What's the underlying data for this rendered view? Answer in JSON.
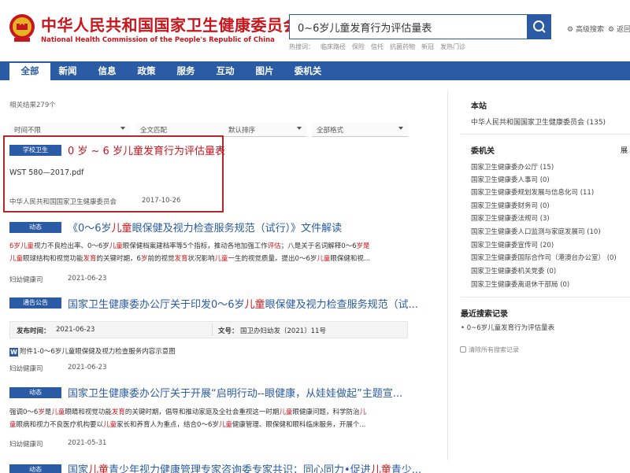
{
  "header": {
    "logo_cn": "中华人民共和国国家卫生健康委员会",
    "logo_en": "National Health Commission of the People's Republic of China",
    "search_value": "0~6岁儿童发育行为评估量表",
    "hot_label": "热搜词：",
    "hot_terms": [
      "临床路径",
      "保险",
      "信托",
      "抗菌药物",
      "新冠",
      "发热门诊"
    ],
    "adv_search": "高级搜索",
    "adv_search2": "返回"
  },
  "nav": [
    "全部",
    "新闻",
    "信息",
    "政策",
    "服务",
    "互动",
    "图片",
    "委机关"
  ],
  "result_count": "相关结果279个",
  "filters": [
    "时间不限",
    "全文匹配",
    "默认排序",
    "全部格式"
  ],
  "results": {
    "r1": {
      "tag": "学校卫生",
      "title": "0 岁 ~ 6 岁儿童发育行为评估量表",
      "file": "WST 580—2017.pdf",
      "source": "中华人民共和国国家卫生健康委员会",
      "date": "2017-10-26"
    },
    "r2": {
      "tag": "动态",
      "title_a": "《0～6岁",
      "title_b": "儿童",
      "title_c": "眼保健及视力检查服务规范（试行）》文件解读",
      "line1_a": "6岁",
      "line1_b": "儿童",
      "line1_c": "视力不良检出率、0～6岁",
      "line1_d": "儿童",
      "line1_e": "眼保健档案建档率等5个指标，推动各地加强工作",
      "line1_f": "评估",
      "line1_g": "；八是关于名词解释0～6",
      "line1_h": "岁是",
      "line2_a": "儿童",
      "line2_b": "眼球结构和视觉功能",
      "line2_c": "发育",
      "line2_d": "的关键时期，6",
      "line2_e": "岁",
      "line2_f": "前的视觉",
      "line2_g": "发育",
      "line2_h": "状况影响",
      "line2_i": "儿童",
      "line2_j": "一生的视觉质量。提出0～6岁",
      "line2_k": "儿童",
      "line2_l": "眼保健和视...",
      "source": "妇幼健康司",
      "date": "2021-06-23"
    },
    "r3": {
      "tag": "通告公告",
      "title_a": "国家卫生健康委办公厅关于印发0～6岁",
      "title_b": "儿童",
      "title_c": "眼保健及视力检查服务规范（试...",
      "pub_label": "发布时间：",
      "pub_value": "2021-06-23",
      "doc_label": "文号：",
      "doc_value": "国卫办妇幼发〔2021〕11号",
      "attach": "附件1-0～6岁儿童眼保健及视力检查服务内容示意图",
      "source": "妇幼健康司",
      "date": "2021-06-23"
    },
    "r4": {
      "tag": "动态",
      "title": "国家卫生健康委办公厅关于开展“启明行动--眼健康，从娃娃做起”主题宣...",
      "line1_a": "强调0～6",
      "line1_b": "岁",
      "line1_c": "是",
      "line1_d": "儿童",
      "line1_e": "眼睛和视觉功能",
      "line1_f": "发育",
      "line1_g": "的关键时期，倡导和推动家庭及全社会重视这一时期",
      "line1_h": "儿童",
      "line1_i": "眼健康问题，科学防治",
      "line1_j": "儿",
      "line2_a": "童",
      "line2_b": "眼病和视力不良医疗机构要以",
      "line2_c": "儿童",
      "line2_d": "家长和养育人为重点，结合0～6岁",
      "line2_e": "儿童",
      "line2_f": "健康管理、眼保健和眼科临床服务，开展个...",
      "source": "妇幼健康司",
      "date": "2021-05-31"
    },
    "r5": {
      "tag": "动态",
      "title_a": "国家",
      "title_b": "儿童",
      "title_c": "青少年视力健康管理专家咨询委专家共识：同心同力•促进",
      "title_d": "儿童",
      "title_e": "青少..."
    }
  },
  "sidebar": {
    "site_heading": "本站",
    "site_item": "中华人民共和国国家卫生健康委员会 (135)",
    "org_heading": "委机关",
    "org_more": "展",
    "org_items": [
      "国家卫生健康委办公厅 (15)",
      "国家卫生健康委人事司 (0)",
      "国家卫生健康委规划发展与信息化司 (11)",
      "国家卫生健康委财务司 (0)",
      "国家卫生健康委法规司 (3)",
      "国家卫生健康委人口监测与家庭发展司 (10)",
      "国家卫生健康委宣传司 (20)",
      "国家卫生健康委国际合作司（港澳台办公室） (0)",
      "国家卫生健康委机关党委 (0)",
      "国家卫生健康委离退休干部局 (0)"
    ],
    "recent_heading": "最近搜索记录",
    "recent_item": "0~6岁儿童发育行为评估量表",
    "clear": "清除所有搜索记录"
  },
  "colors": {
    "brand_red": "#c8161d",
    "brand_blue": "#2a5ba4"
  }
}
